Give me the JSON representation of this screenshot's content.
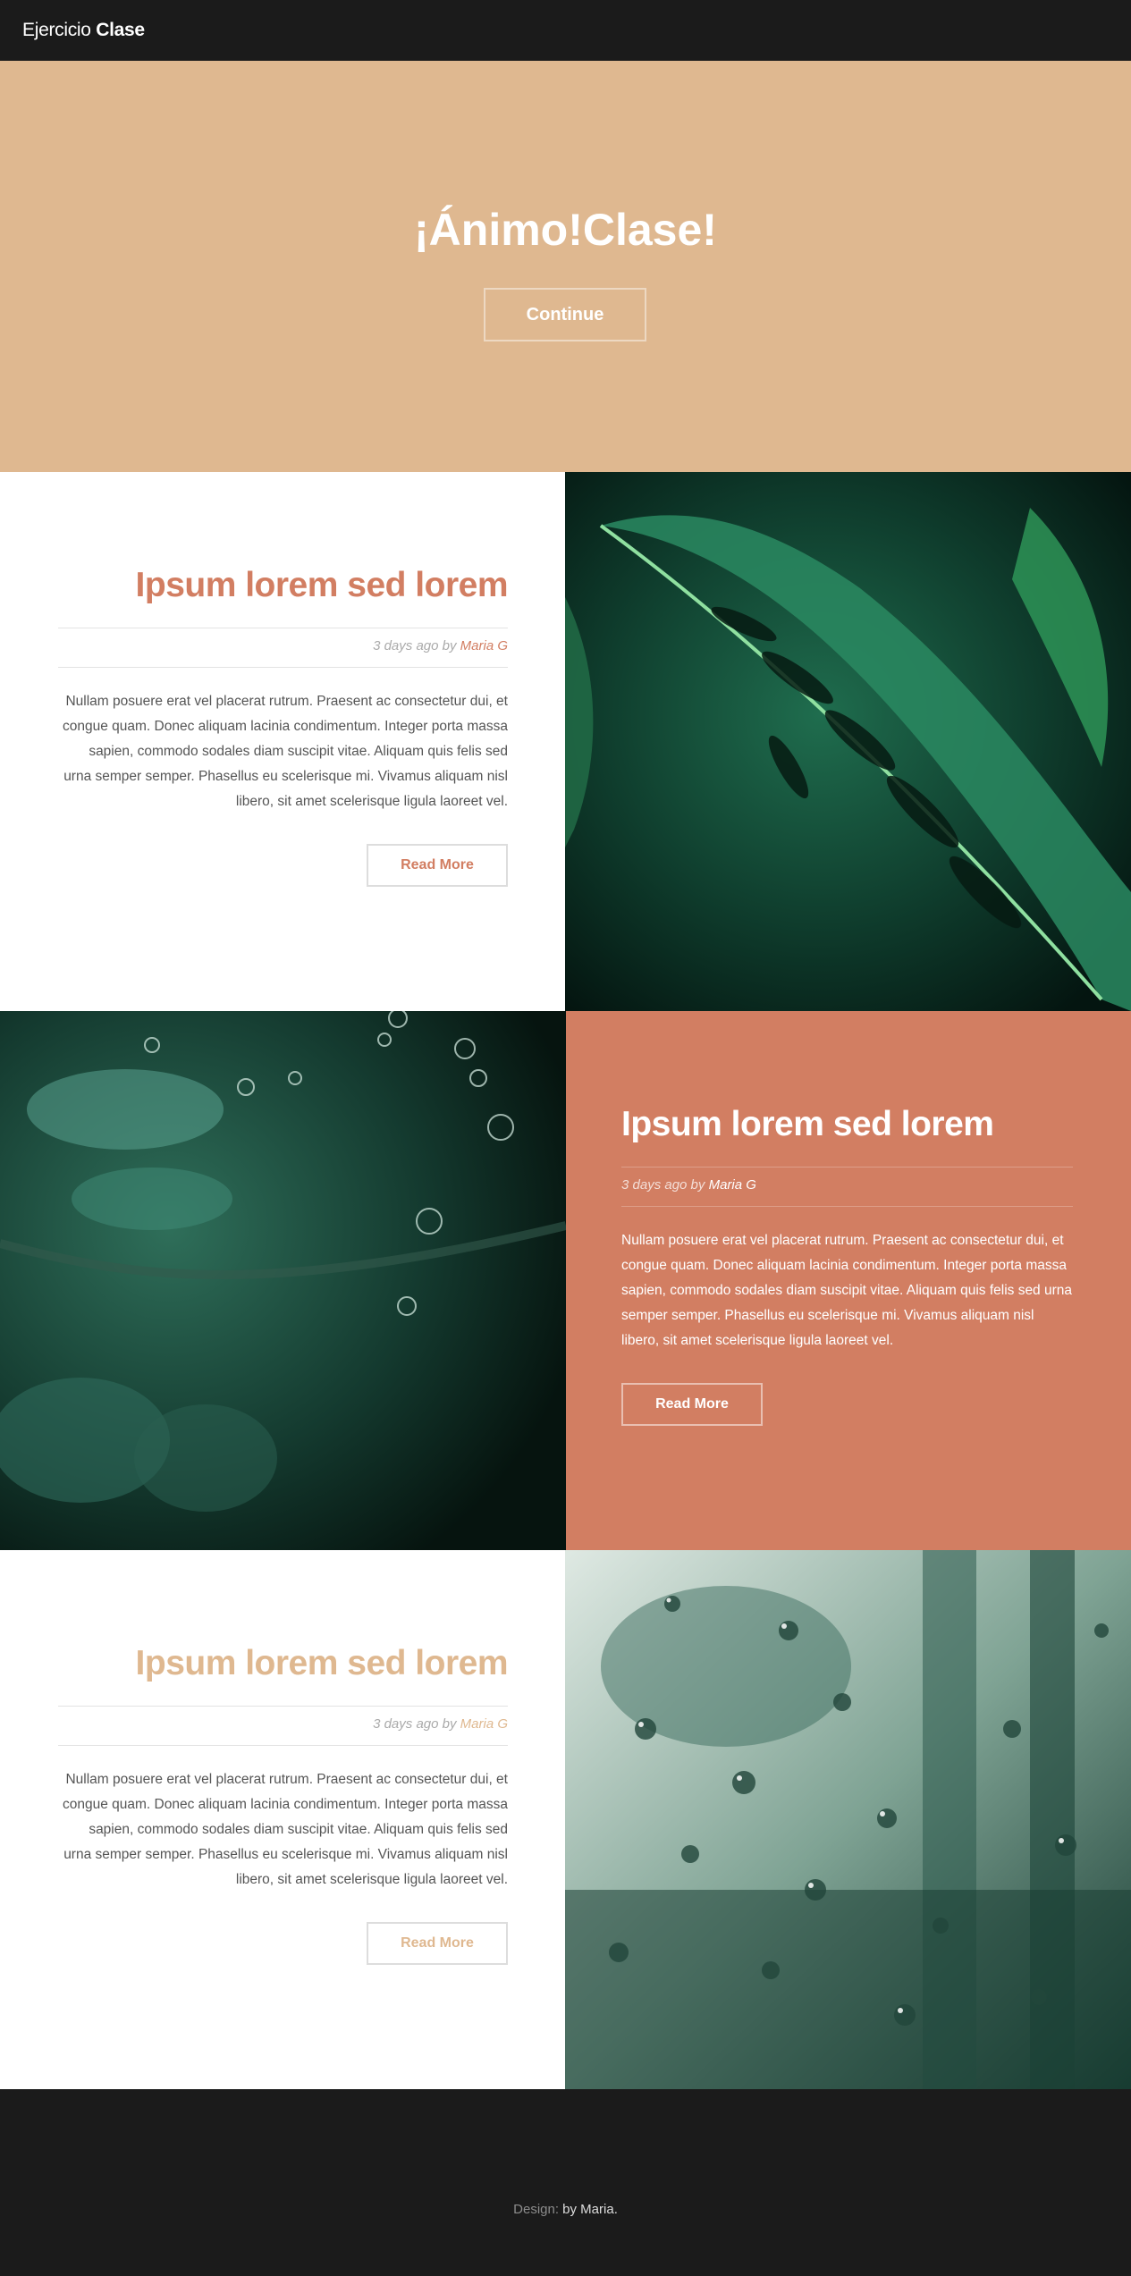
{
  "header": {
    "brand_light": "Ejercicio",
    "brand_bold": "Clase"
  },
  "banner": {
    "title": "¡Ánimo!Clase!",
    "button_label": "Continue",
    "background": "#dfb890"
  },
  "spotlights": [
    {
      "title": "Ipsum lorem sed lorem",
      "meta_time": "3 days ago by",
      "author": "Maria G",
      "body": "Nullam posuere erat vel placerat rutrum. Praesent ac consectetur dui, et congue quam. Donec aliquam lacinia condimentum. Integer porta massa sapien, commodo sodales diam suscipit vitae. Aliquam quis felis sed urna semper semper. Phasellus eu scelerisque mi. Vivamus aliquam nisl libero, sit amet scelerisque ligula laoreet vel.",
      "button_label": "Read More",
      "accent": "#d27e62",
      "image_icon": "monstera-leaf-photo"
    },
    {
      "title": "Ipsum lorem sed lorem",
      "meta_time": "3 days ago by",
      "author": "Maria G",
      "body": "Nullam posuere erat vel placerat rutrum. Praesent ac consectetur dui, et congue quam. Donec aliquam lacinia condimentum. Integer porta massa sapien, commodo sodales diam suscipit vitae. Aliquam quis felis sed urna semper semper. Phasellus eu scelerisque mi. Vivamus aliquam nisl libero, sit amet scelerisque ligula laoreet vel.",
      "button_label": "Read More",
      "accent": "#d27e62",
      "image_icon": "dew-plant-photo"
    },
    {
      "title": "Ipsum lorem sed lorem",
      "meta_time": "3 days ago by",
      "author": "Maria G",
      "body": "Nullam posuere erat vel placerat rutrum. Praesent ac consectetur dui, et congue quam. Donec aliquam lacinia condimentum. Integer porta massa sapien, commodo sodales diam suscipit vitae. Aliquam quis felis sed urna semper semper. Phasellus eu scelerisque mi. Vivamus aliquam nisl libero, sit amet scelerisque ligula laoreet vel.",
      "button_label": "Read More",
      "accent": "#dfb890",
      "image_icon": "raindrops-window-photo"
    }
  ],
  "footer": {
    "label": "Design:",
    "by": "by Maria."
  }
}
